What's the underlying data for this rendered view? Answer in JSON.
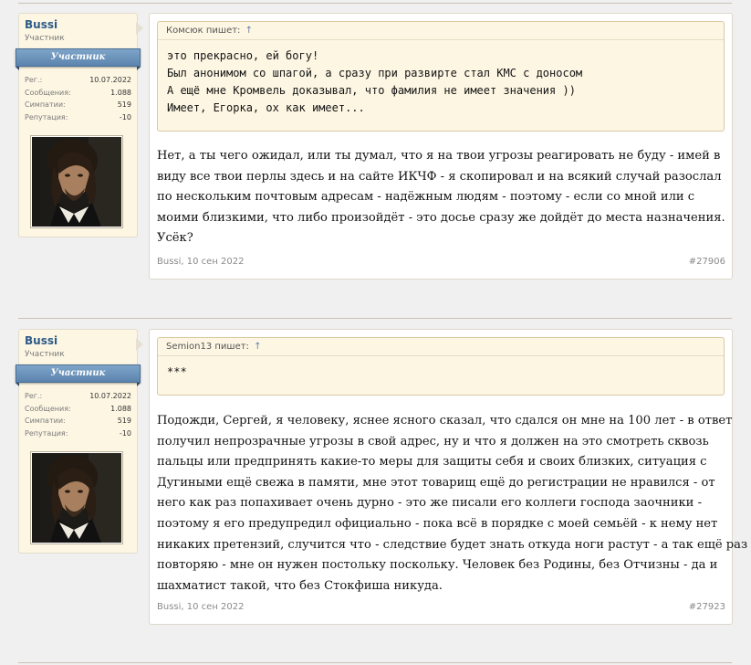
{
  "posts": [
    {
      "user": {
        "name": "Bussi",
        "title": "Участник",
        "rank": "Участник",
        "stats": [
          {
            "label": "Рег.:",
            "value": "10.07.2022"
          },
          {
            "label": "Сообщения:",
            "value": "1.088"
          },
          {
            "label": "Симпатии:",
            "value": "519"
          },
          {
            "label": "Репутация:",
            "value": "-10"
          }
        ]
      },
      "quote": {
        "author": "Комсюк пишет:",
        "up": "↑",
        "lines": [
          "это прекрасно, ей богу!",
          "Был анонимом со шпагой, а сразу при развирте стал КМС с доносом",
          "А ещё мне Кромвель доказывал, что фамилия не имеет значения ))",
          "Имеет, Егорка, ох как имеет..."
        ]
      },
      "lines": [
        "Нет, а ты чего ожидал, или ты думал, что я на твои угрозы реагировать не буду - имей в",
        "виду все твои перлы здесь и на сайте ИКЧФ - я скопировал и на всякий случай разослал",
        "по нескольким почтовым адресам - надёжным людям - поэтому - если со мной или с",
        "моими близкими, что либо произойдёт - это досье сразу же дойдёт до места назначения.",
        "Усёк?"
      ],
      "footer": {
        "author": "Bussi",
        "date": ", 10 сен 2022",
        "number": "#27906"
      }
    },
    {
      "user": {
        "name": "Bussi",
        "title": "Участник",
        "rank": "Участник",
        "stats": [
          {
            "label": "Рег.:",
            "value": "10.07.2022"
          },
          {
            "label": "Сообщения:",
            "value": "1.088"
          },
          {
            "label": "Симпатии:",
            "value": "519"
          },
          {
            "label": "Репутация:",
            "value": "-10"
          }
        ]
      },
      "quote": {
        "author": "Semion13 пишет:",
        "up": "↑",
        "lines": [
          "***"
        ]
      },
      "lines": [
        "Подожди, Сергей, я человеку, яснее ясного сказал, что сдался он мне на 100 лет - в ответ",
        "получил непрозрачные угрозы в свой адрес, ну и что я должен на это смотреть сквозь",
        "пальцы или предпринять какие-то меры для защиты себя и своих близких, ситуация с",
        "Дугиными ещё свежа в памяти, мне этот товарищ ещё до регистрации не нравился - от",
        "него как раз попахивает очень дурно - это же писали его коллеги господа заочники -",
        "поэтому я его предупредил официально - пока всё в порядке с моей семьёй - к нему нет",
        "никаких претензий, случится что - следствие будет знать откуда ноги растут - а так ещё раз",
        "повторяю - мне он нужен постольку поскольку. Человек без Родины, без Отчизны - да и",
        "шахматист такой, что без Стокфиша никуда."
      ],
      "footer": {
        "author": "Bussi",
        "date": ", 10 сен 2022",
        "number": "#27923"
      }
    }
  ]
}
